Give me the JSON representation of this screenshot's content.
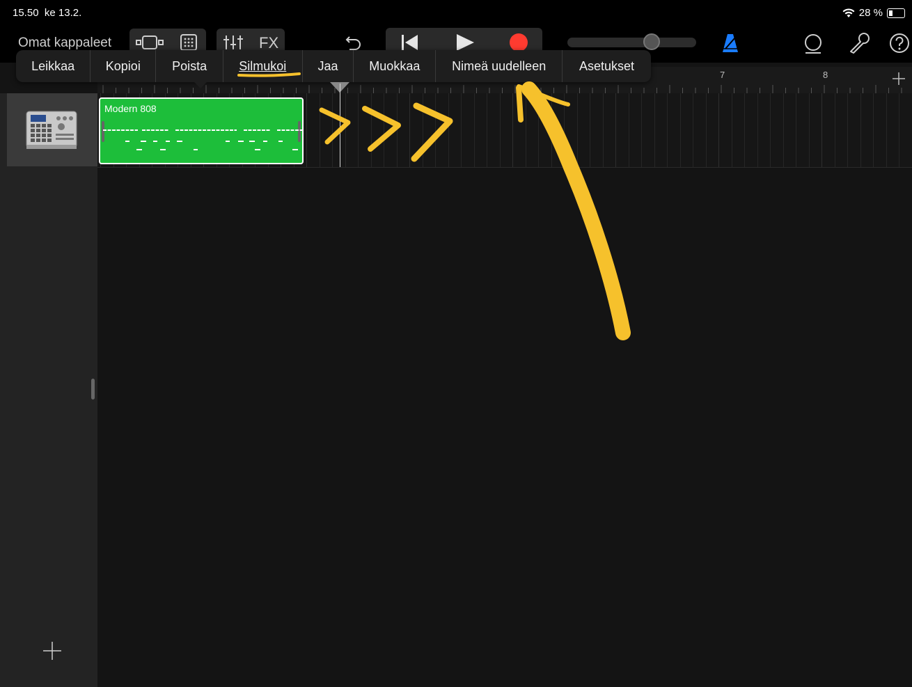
{
  "status_bar": {
    "time": "15.50",
    "date": "ke 13.2.",
    "battery_text": "28 %"
  },
  "toolbar": {
    "my_songs_label": "Omat kappaleet",
    "fx_label": "FX",
    "icons": {
      "browser": "track-view-icon",
      "grid": "grid-icon",
      "mixer": "mixer-icon",
      "undo": "undo-icon",
      "rewind": "rewind-icon",
      "play": "play-icon",
      "record": "record-icon",
      "metronome": "metronome-icon",
      "loop": "loop-browser-icon",
      "settings": "wrench-icon",
      "help": "help-icon"
    },
    "colors": {
      "record": "#ff3b30",
      "metronome": "#1a7cff"
    }
  },
  "edit_menu": {
    "items": [
      {
        "label": "Leikkaa"
      },
      {
        "label": "Kopioi"
      },
      {
        "label": "Poista"
      },
      {
        "label": "Silmukoi"
      },
      {
        "label": "Jaa"
      },
      {
        "label": "Muokkaa"
      },
      {
        "label": "Nimeä uudelleen"
      },
      {
        "label": "Asetukset"
      }
    ]
  },
  "ruler": {
    "bar_numbers": [
      "7",
      "8"
    ]
  },
  "track": {
    "instrument_icon": "drum-machine-icon",
    "region_name": "Modern 808",
    "region_color": "#1dbe3a"
  },
  "annotation_color": "#f6c12c"
}
